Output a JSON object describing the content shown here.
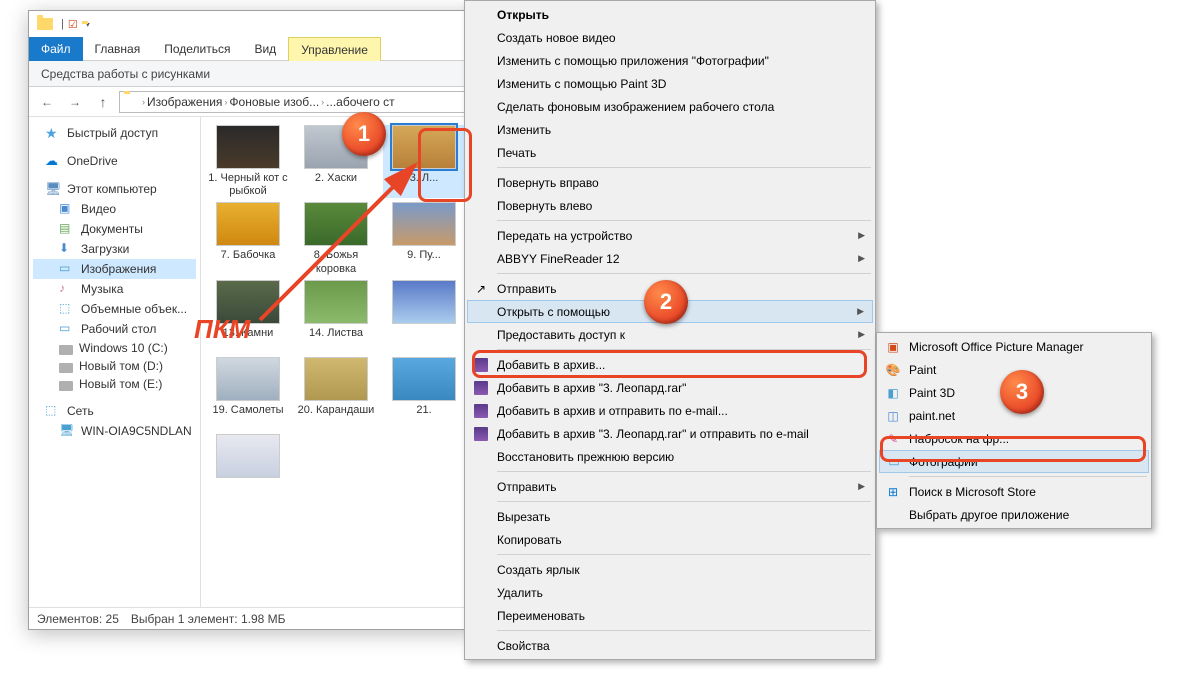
{
  "ribbon": {
    "file": "Файл",
    "home": "Главная",
    "share": "Поделиться",
    "view": "Вид",
    "tool_tab": "Управление",
    "tool_sub": "Средства работы с рисунками"
  },
  "breadcrumb": {
    "root": "Изображения",
    "folder": "Фоновые изоб...",
    "sub": "...абочего ст"
  },
  "nav": {
    "quick": "Быстрый доступ",
    "onedrive": "OneDrive",
    "thispc": "Этот компьютер",
    "video": "Видео",
    "documents": "Документы",
    "downloads": "Загрузки",
    "pictures": "Изображения",
    "music": "Музыка",
    "objects3d": "Объемные объек...",
    "desktop": "Рабочий стол",
    "drive_c": "Windows 10 (C:)",
    "drive_d": "Новый том (D:)",
    "drive_e": "Новый том (E:)",
    "network": "Сеть",
    "net_pc": "WIN-OIA9C5NDLAN"
  },
  "files": [
    {
      "label": "1. Черный кот с рыбкой"
    },
    {
      "label": "2. Хаски"
    },
    {
      "label": "3. Л..."
    },
    {
      "label": "7. Бабочка"
    },
    {
      "label": "8. Божья коровка"
    },
    {
      "label": "9. Пу..."
    },
    {
      "label": "13. Камни"
    },
    {
      "label": "14. Листва"
    },
    {
      "label": ""
    },
    {
      "label": "19. Самолеты"
    },
    {
      "label": "20. Карандаши"
    },
    {
      "label": "21."
    },
    {
      "label": ""
    }
  ],
  "status": {
    "count": "Элементов: 25",
    "selection": "Выбран 1 элемент: 1.98 МБ"
  },
  "ctx1": {
    "open": "Открыть",
    "newvideo": "Создать новое видео",
    "editphotos": "Изменить с помощью приложения \"Фотографии\"",
    "paint3d": "Изменить с помощью Paint 3D",
    "setbg": "Сделать фоновым изображением рабочего стола",
    "edit": "Изменить",
    "print": "Печать",
    "rotr": "Повернуть вправо",
    "rotl": "Повернуть влево",
    "cast": "Передать на устройство",
    "abbyy": "ABBYY FineReader 12",
    "send1": "Отправить",
    "openwith": "Открыть с помощью",
    "share": "Предоставить доступ к",
    "addarch": "Добавить в архив...",
    "addrar": "Добавить в архив \"3. Леопард.rar\"",
    "addmail": "Добавить в архив и отправить по e-mail...",
    "addrarmail": "Добавить в архив \"3. Леопард.rar\" и отправить по e-mail",
    "restore": "Восстановить прежнюю версию",
    "sendto": "Отправить",
    "cut": "Вырезать",
    "copy": "Копировать",
    "shortcut": "Создать ярлык",
    "delete": "Удалить",
    "rename": "Переименовать",
    "props": "Свойства"
  },
  "ctx2": {
    "mspm": "Microsoft Office Picture Manager",
    "paint": "Paint",
    "paint3d": "Paint 3D",
    "paintnet": "paint.net",
    "sketch": "Набросок на фр...",
    "photos": "Фотографии",
    "store": "Поиск в Microsoft Store",
    "other": "Выбрать другое приложение"
  },
  "annotations": {
    "pkm": "ПКМ"
  }
}
